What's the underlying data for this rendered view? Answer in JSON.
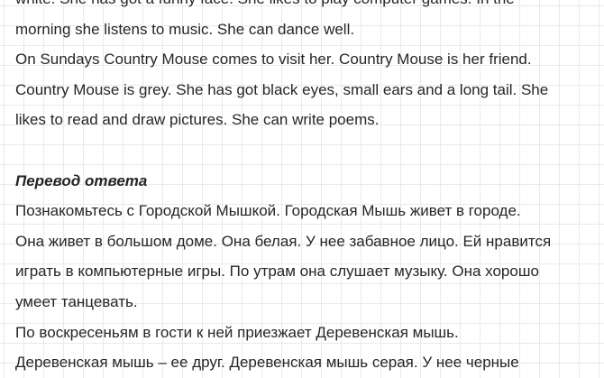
{
  "document": {
    "english_lines": [
      "white. She has got a funny face. She likes to play computer games. In the",
      "morning she listens to music. She can dance well.",
      "On Sundays Country Mouse comes to visit her. Country Mouse is her friend.",
      "Country Mouse is grey. She has got black eyes, small ears and a long tail. She",
      "likes to read and draw pictures. She can write poems."
    ],
    "translation_heading": "Перевод ответа",
    "russian_lines": [
      "Познакомьтесь с Городской Мышкой. Городская Мышь живет в городе.",
      "Она живет в большом доме. Она белая. У нее забавное лицо. Ей нравится",
      "играть в компьютерные игры. По утрам она слушает музыку. Она хорошо",
      "умеет танцевать.",
      "По воскресеньям в гости к ней приезжает Деревенская мышь.",
      "Деревенская мышь – ее друг. Деревенская мышь серая. У нее черные"
    ]
  }
}
